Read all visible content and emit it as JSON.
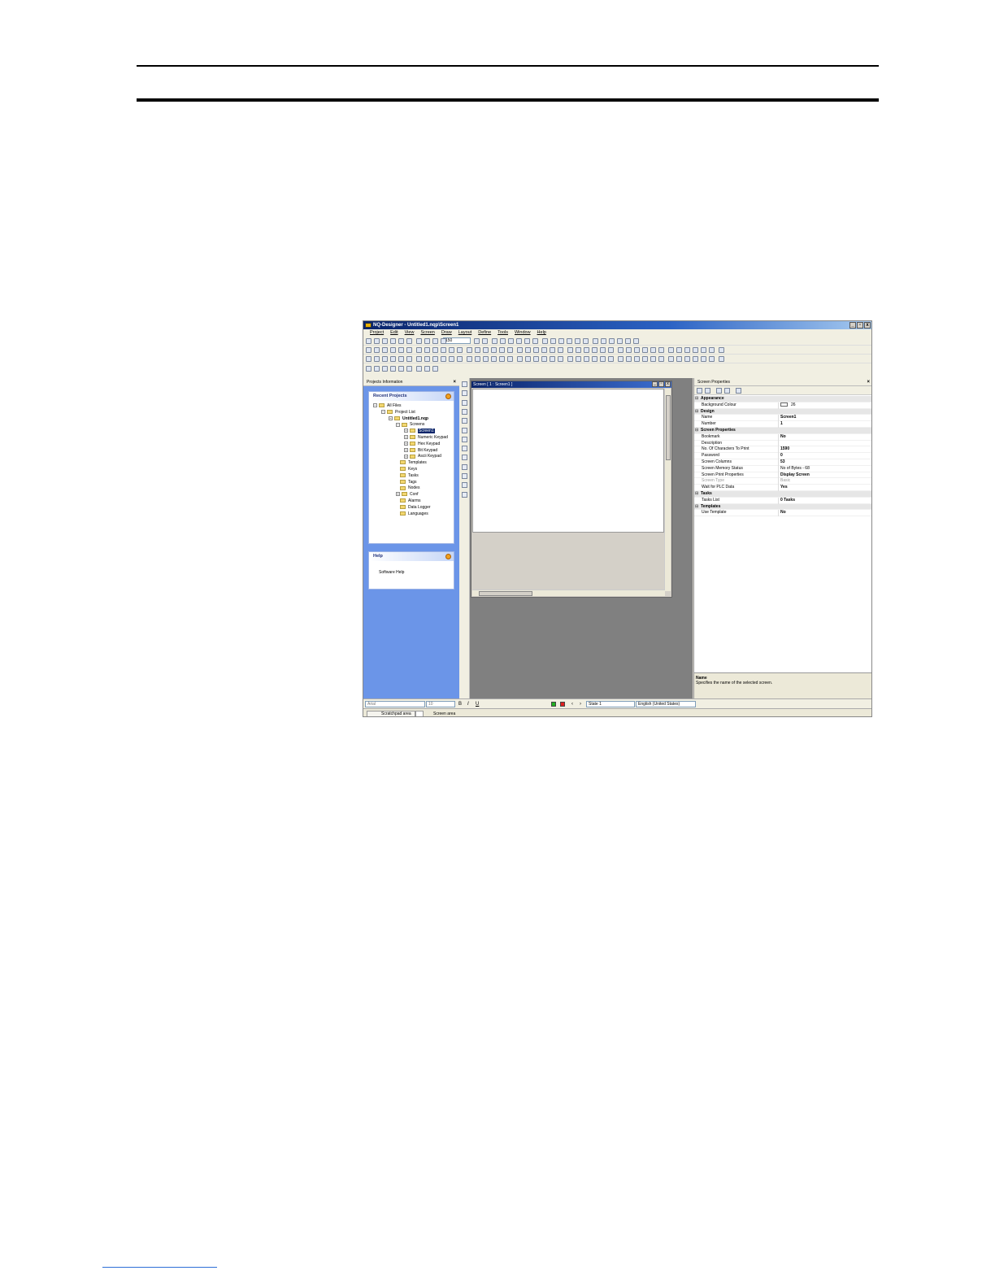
{
  "app": {
    "title": "NQ-Designer - Untitled1.nqp\\Screen1",
    "window_buttons": [
      "_",
      "▫",
      "x"
    ],
    "menu": [
      "Project",
      "Edit",
      "View",
      "Screen",
      "Draw",
      "Layout",
      "Define",
      "Tools",
      "Window",
      "Help"
    ],
    "zoom_value": "150"
  },
  "projects_panel": {
    "title": "Projects Information",
    "close_glyph": "×",
    "recent_projects_title": "Recent Projects",
    "tree": [
      {
        "label": "All Files"
      },
      {
        "label": "Project List"
      },
      {
        "label": "Untitled1.nqp"
      },
      {
        "label": "Screens"
      },
      {
        "label": "Screen1"
      },
      {
        "label": "Numeric Keypad"
      },
      {
        "label": "Hex Keypad"
      },
      {
        "label": "Bit Keypad"
      },
      {
        "label": "Ascii Keypad"
      },
      {
        "label": "Templates"
      },
      {
        "label": "Keys"
      },
      {
        "label": "Tasks"
      },
      {
        "label": "Tags"
      },
      {
        "label": "Nodes"
      },
      {
        "label": "Conf"
      },
      {
        "label": "Alarms"
      },
      {
        "label": "Data Logger"
      },
      {
        "label": "Languages"
      }
    ],
    "help_title": "Help",
    "help_item": "Software Help"
  },
  "screen_window": {
    "title": "Screen [ 1 : Screen1 ]"
  },
  "properties_panel": {
    "title": "Screen Properties",
    "close_glyph": "×",
    "rows": [
      {
        "kind": "category",
        "name": "Appearance"
      },
      {
        "kind": "prop",
        "name": "Background Colour",
        "value": "26",
        "swatch": "#ffffff"
      },
      {
        "kind": "category",
        "name": "Design"
      },
      {
        "kind": "prop",
        "name": "Name",
        "value": "Screen1",
        "bold": true
      },
      {
        "kind": "prop",
        "name": "Number",
        "value": "1",
        "bold": true
      },
      {
        "kind": "category",
        "name": "Screen Properties"
      },
      {
        "kind": "prop",
        "name": "Bookmark",
        "value": "No",
        "bold": true
      },
      {
        "kind": "prop",
        "name": "Description",
        "value": ""
      },
      {
        "kind": "prop",
        "name": "No. Of Characters To Print",
        "value": "1590",
        "bold": true
      },
      {
        "kind": "prop",
        "name": "Password",
        "value": "0",
        "bold": true
      },
      {
        "kind": "prop",
        "name": "Screen Columns",
        "value": "53",
        "bold": true
      },
      {
        "kind": "prop",
        "name": "Screen Memory Status",
        "value": "No of Bytes - 68"
      },
      {
        "kind": "prop",
        "name": "Screen Print Properties",
        "value": "Display Screen",
        "bold": true
      },
      {
        "kind": "prop",
        "name": "Screen Type",
        "value": "Basic",
        "grey": true
      },
      {
        "kind": "prop",
        "name": "Wait for PLC Data",
        "value": "Yes",
        "bold": true
      },
      {
        "kind": "category",
        "name": "Tasks"
      },
      {
        "kind": "prop",
        "name": "Tasks List",
        "value": "0 Tasks",
        "bold": true
      },
      {
        "kind": "category",
        "name": "Templates"
      },
      {
        "kind": "prop",
        "name": "Use Template",
        "value": "No",
        "bold": true
      }
    ],
    "description_title": "Name",
    "description_text": "Specifies the name of the selected screen."
  },
  "format_bar": {
    "font": "Arial",
    "size": "10",
    "state": "State 1",
    "language": "English (United States)",
    "colors": {
      "green": "#22b022",
      "red": "#e02020"
    }
  },
  "status_bar": {
    "scratchpad": "Scratchpad area",
    "screen_area": "Screen area"
  }
}
